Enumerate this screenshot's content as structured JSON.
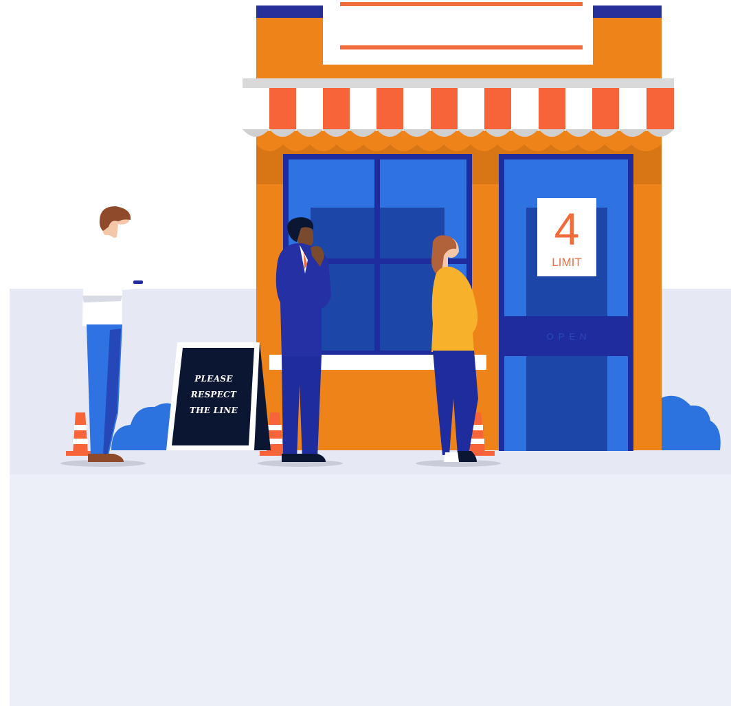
{
  "sign": {
    "line1": "PLEASE",
    "line2": "RESPECT",
    "line3": "THE LINE"
  },
  "door_sign": {
    "number": "4",
    "label": "LIMIT"
  },
  "door_band": {
    "text": "OPEN"
  },
  "colors": {
    "storefront_orange": "#ee8419",
    "window_blue": "#2d6fdf",
    "navy": "#1e2a9c",
    "awning_red": "#f7643a",
    "ground": "#e6e9f4"
  }
}
